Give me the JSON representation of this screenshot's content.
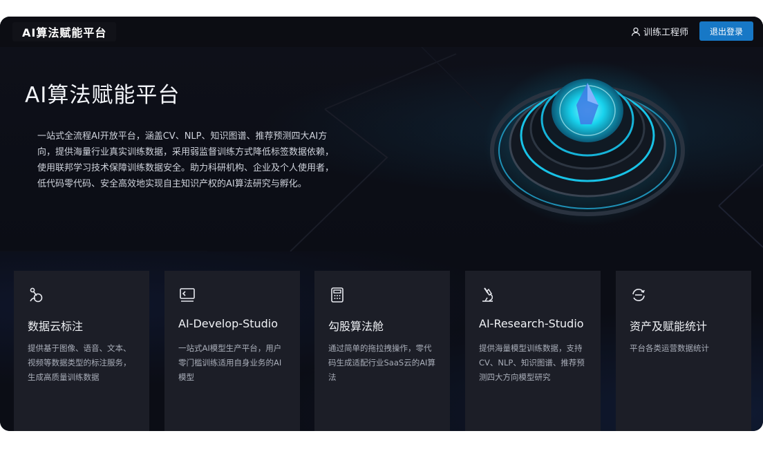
{
  "header": {
    "brand": "AI算法赋能平台",
    "user_name": "训练工程师",
    "logout_label": "退出登录"
  },
  "hero": {
    "title": "AI算法赋能平台",
    "description": "一站式全流程AI开放平台，涵盖CV、NLP、知识图谱、推荐预测四大AI方向，提供海量行业真实训练数据，采用弱监督训练方式降低标签数据依赖，使用联邦学习技术保障训练数据安全。助力科研机构、企业及个人使用者，低代码零代码、安全高效地实现自主知识产权的AI算法研究与孵化。"
  },
  "cards": [
    {
      "icon": "data-label-icon",
      "title": "数据云标注",
      "desc": "提供基于图像、语音、文本、视频等数据类型的标注服务，生成高质量训练数据"
    },
    {
      "icon": "code-terminal-icon",
      "title": "AI-Develop-Studio",
      "desc": "一站式AI模型生产平台，用户零门槛训练适用自身业务的AI模型"
    },
    {
      "icon": "calculator-icon",
      "title": "勾股算法舱",
      "desc": "通过简单的拖拉拽操作，零代码生成适配行业SaaS云的AI算法"
    },
    {
      "icon": "microscope-icon",
      "title": "AI-Research-Studio",
      "desc": "提供海量模型训练数据，支持CV、NLP、知识图谱、推荐预测四大方向模型研究"
    },
    {
      "icon": "sync-icon",
      "title": "资产及赋能统计",
      "desc": "平台各类运营数据统计"
    }
  ],
  "colors": {
    "accent": "#1778c6",
    "glow": "#19d3ee",
    "card_bg": "#1c1e27"
  }
}
